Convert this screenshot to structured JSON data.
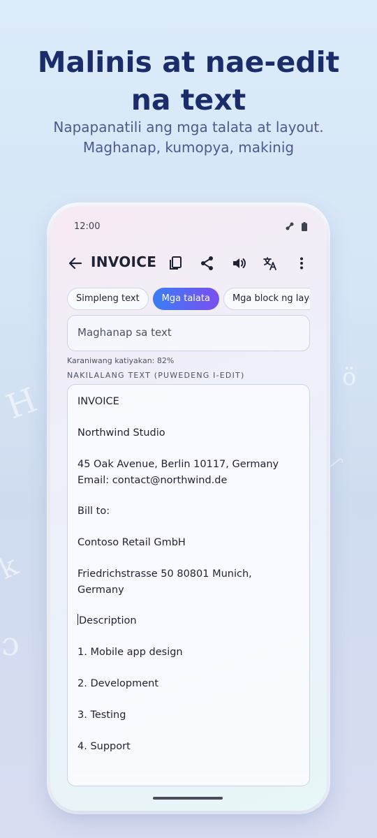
{
  "headline": "Malinis at nae-edit na text",
  "subheadline_line1": "Napapanatili ang mga talata at layout.",
  "subheadline_line2": "Maghanap, kumopya, makinig",
  "status_bar": {
    "time": "12:00",
    "icons": [
      "signal-icon",
      "battery-icon"
    ]
  },
  "app_bar": {
    "title": "INVOICE",
    "actions": [
      "copy-icon",
      "share-icon",
      "speaker-icon",
      "translate-icon",
      "more-icon"
    ]
  },
  "tabs": [
    {
      "label": "Simpleng text",
      "active": false
    },
    {
      "label": "Mga talata",
      "active": true
    },
    {
      "label": "Mga block ng layout",
      "active": false
    }
  ],
  "search": {
    "placeholder": "Maghanap sa text"
  },
  "confidence_label": "Karaniwang katiyakan: 82%",
  "section_label": "NAKILALANG TEXT (PUWEDENG I-EDIT)",
  "paragraphs": [
    [
      "INVOICE"
    ],
    [
      "Northwind Studio"
    ],
    [
      "45 Oak Avenue, Berlin 10117, Germany",
      "Email: contact@northwind.de"
    ],
    [
      "Bill to:"
    ],
    [
      "Contoso Retail GmbH"
    ],
    [
      "Friedrichstrasse 50 80801 Munich,",
      "Germany"
    ],
    [
      "Description"
    ],
    [
      "1. Mobile app design"
    ],
    [
      "2. Development"
    ],
    [
      "3. Testing"
    ],
    [
      "4. Support"
    ]
  ],
  "colors": {
    "headline": "#1b2c6b",
    "accent_start": "#3a7df5",
    "accent_end": "#7b4ff0"
  }
}
